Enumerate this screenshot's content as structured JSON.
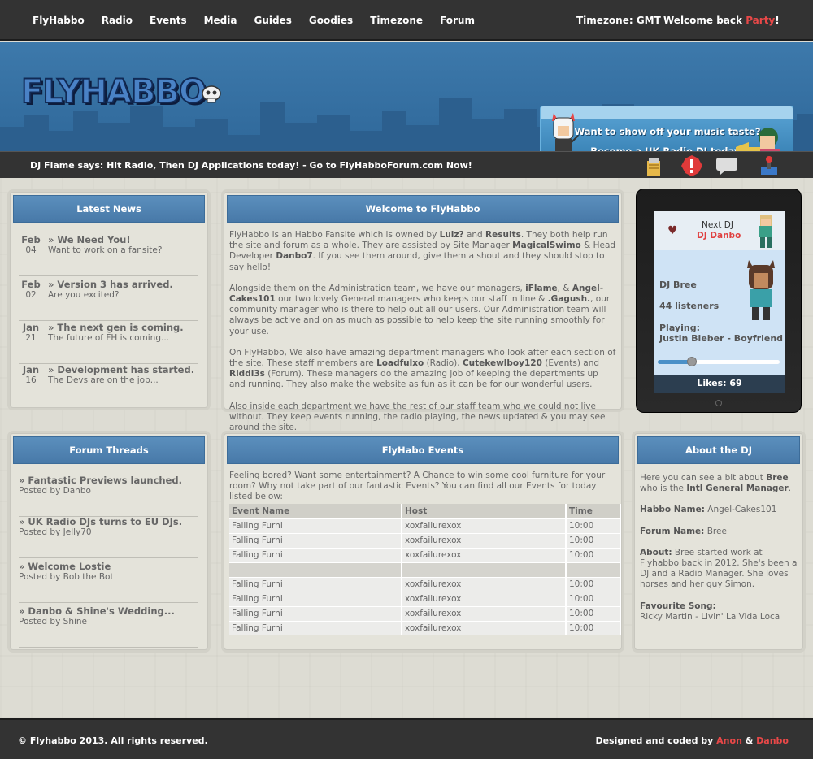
{
  "nav": {
    "links": [
      "FlyHabbo",
      "Radio",
      "Events",
      "Media",
      "Guides",
      "Goodies",
      "Timezone",
      "Forum"
    ],
    "timezone": "Timezone: GMT",
    "welcome_prefix": "Welcome back ",
    "username": "Party",
    "welcome_suffix": "!"
  },
  "header": {
    "logo_text": "FLYHABBO",
    "banner_line1": "Want to show off your music taste?",
    "banner_line2": "Become a UK Radio DJ today!"
  },
  "shout": {
    "message": "DJ Flame says: Hit Radio, Then DJ Applications today! - Go to FlyHabboForum.com Now!"
  },
  "news": {
    "title": "Latest News",
    "items": [
      {
        "month": "Feb",
        "day": "04",
        "title": "» We Need You!",
        "sub": "Want to work on a fansite?"
      },
      {
        "month": "Feb",
        "day": "02",
        "title": "» Version 3 has arrived.",
        "sub": "Are you excited?"
      },
      {
        "month": "Jan",
        "day": "21",
        "title": "» The next gen is coming.",
        "sub": "The future of FH is coming..."
      },
      {
        "month": "Jan",
        "day": "16",
        "title": "» Development has started.",
        "sub": "The Devs are on the job..."
      }
    ]
  },
  "welcome": {
    "title": "Welcome to FlyHabbo",
    "p1": [
      {
        "t": "FlyHabbo is an Habbo Fansite which is owned by "
      },
      {
        "b": "Lulz?"
      },
      {
        "t": " and "
      },
      {
        "b": "Results"
      },
      {
        "t": ". They both help run the site and forum as a whole. They are assisted by Site Manager "
      },
      {
        "b": "MagicalSwimo"
      },
      {
        "t": " & Head Developer "
      },
      {
        "b": "Danbo7"
      },
      {
        "t": ". If you see them around, give them a shout and they should stop to say hello!"
      }
    ],
    "p2": [
      {
        "t": "Alongside them on the Administration team, we have our managers, "
      },
      {
        "b": "iFlame"
      },
      {
        "t": ", & "
      },
      {
        "b": "Angel-Cakes101"
      },
      {
        "t": " our two lovely General managers who keeps our staff in line & "
      },
      {
        "b": ".Gagush."
      },
      {
        "t": ", our community manager who is there to help out all our users. Our Administration team will always be active and on as much as possible to help keep the site running smoothly for your use."
      }
    ],
    "p3": [
      {
        "t": "On FlyHabbo, We also have amazing department managers who look after each section of the site. These staff members are "
      },
      {
        "b": "Loadfulxo"
      },
      {
        "t": " (Radio), "
      },
      {
        "b": "Cutekewlboy120"
      },
      {
        "t": " (Events) and "
      },
      {
        "b": "Riddl3s"
      },
      {
        "t": " (Forum). These managers do the amazing job of keeping the departments up and running. They also make the website as fun as it can be for our wonderful users."
      }
    ],
    "p4": [
      {
        "t": "Also inside each department we have the rest of our staff team who we could not live without. They keep events running, the radio playing, the news updated & you may see around the site."
      }
    ]
  },
  "radio": {
    "next_dj_label": "Next DJ",
    "next_dj": "DJ Danbo",
    "current_dj": "DJ Bree",
    "listeners": "44 listeners",
    "playing_label": "Playing:",
    "song": "Justin Bieber - Boyfriend",
    "volume_fraction": 0.28,
    "likes": "Likes: 69"
  },
  "forum": {
    "title": "Forum Threads",
    "items": [
      {
        "title": "» Fantastic Previews launched.",
        "sub": "Posted by Danbo"
      },
      {
        "title": "» UK Radio DJs turns to EU DJs.",
        "sub": "Posted by Jelly70"
      },
      {
        "title": "» Welcome Lostie",
        "sub": "Posted by Bob the Bot"
      },
      {
        "title": "» Danbo & Shine's Wedding...",
        "sub": "Posted by Shine"
      }
    ]
  },
  "events": {
    "title": "FlyHabo Events",
    "intro": "Feeling bored? Want some entertainment? A Chance to win some cool furniture for your room? Why not take part of our fantastic Events? You can find all our Events for today listed below:",
    "columns": [
      "Event Name",
      "Host",
      "Time"
    ],
    "rows": [
      [
        "Falling Furni",
        "xoxfailurexox",
        "10:00"
      ],
      [
        "Falling Furni",
        "xoxfailurexox",
        "10:00"
      ],
      [
        "Falling Furni",
        "xoxfailurexox",
        "10:00"
      ],
      [
        "",
        "",
        ""
      ],
      [
        "Falling Furni",
        "xoxfailurexox",
        "10:00"
      ],
      [
        "Falling Furni",
        "xoxfailurexox",
        "10:00"
      ],
      [
        "Falling Furni",
        "xoxfailurexox",
        "10:00"
      ],
      [
        "Falling Furni",
        "xoxfailurexox",
        "10:00"
      ]
    ]
  },
  "about_dj": {
    "title": "About the DJ",
    "intro_a": "Here you can see a bit about ",
    "intro_name": "Bree",
    "intro_b": " who is the ",
    "intro_role": "Intl General Manager",
    "intro_c": ".",
    "habbo_label": "Habbo Name:",
    "habbo_name": " Angel-Cakes101",
    "forum_label": "Forum Name:",
    "forum_name": " Bree",
    "about_label": "About:",
    "about_text": " Bree started work at Flyhabbo back in 2012. She's been a DJ and a Radio Manager. She loves horses and her guy Simon.",
    "song_label": "Favourite Song:",
    "song": "Ricky Martin - Livin' La Vida Loca"
  },
  "footer": {
    "copyright": "© Flyhabbo 2013. All rights reserved.",
    "designed_prefix": "Designed and coded by ",
    "author1": "Anon",
    "amp": " & ",
    "author2": "Danbo"
  }
}
